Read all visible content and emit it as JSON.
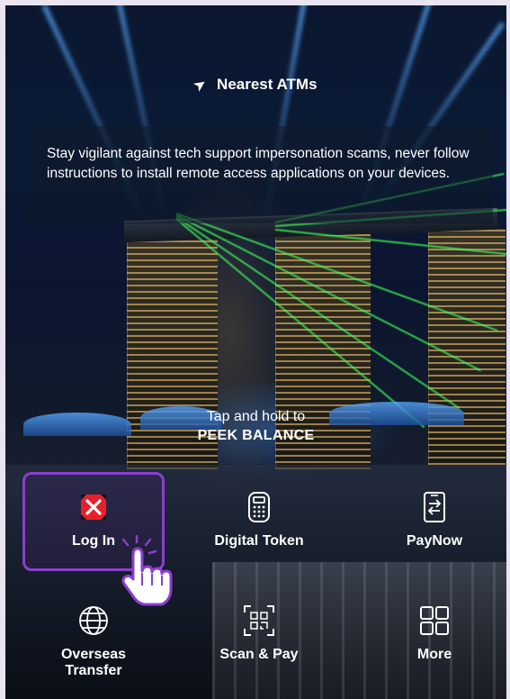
{
  "nearest_atms": {
    "label": "Nearest ATMs",
    "icon": "location-arrow-icon"
  },
  "notice": {
    "text": "Stay vigilant against tech support impersonation scams, never follow instructions to install remote access applications on your devices."
  },
  "peek": {
    "line1": "Tap and hold to",
    "line2": "PEEK BALANCE"
  },
  "actions": [
    {
      "label": "Log In",
      "icon": "dbs-logo-icon",
      "highlighted": true
    },
    {
      "label": "Digital Token",
      "icon": "digital-token-icon"
    },
    {
      "label": "PayNow",
      "icon": "paynow-phone-icon"
    },
    {
      "label": "Overseas\nTransfer",
      "label_line1": "Overseas",
      "label_line2": "Transfer",
      "icon": "globe-icon"
    },
    {
      "label": "Scan & Pay",
      "icon": "qr-scan-icon"
    },
    {
      "label": "More",
      "icon": "grid-icon"
    }
  ],
  "colors": {
    "highlight": "#8a3fcf",
    "brand_red": "#e8202a",
    "laser_green": "#3cff5a"
  },
  "pointer": {
    "icon": "hand-pointer-icon"
  }
}
